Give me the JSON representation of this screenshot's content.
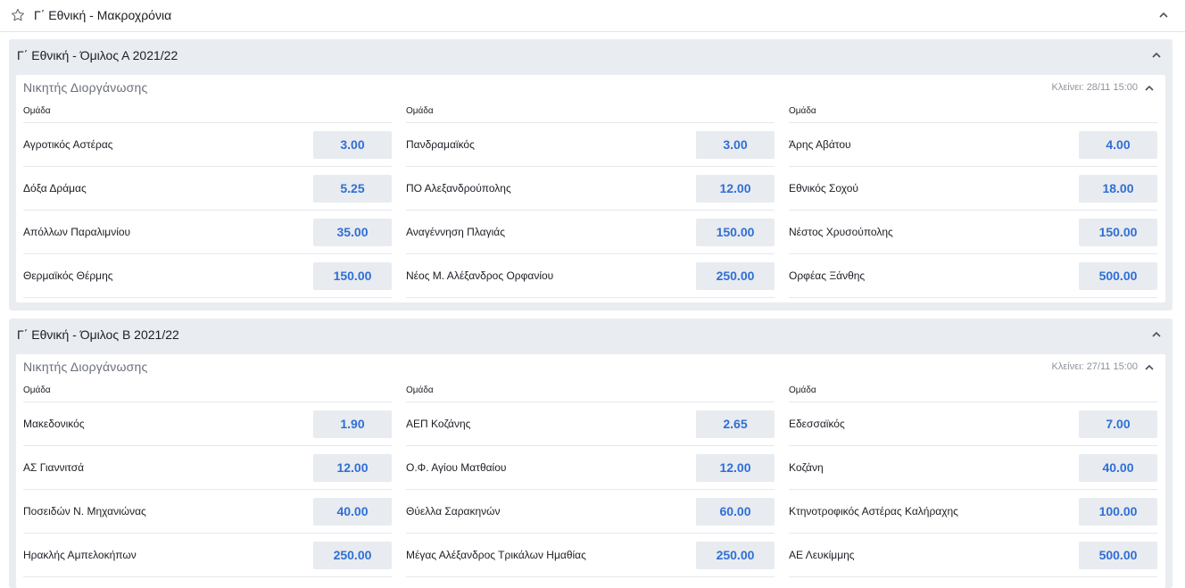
{
  "header": {
    "title": "Γ΄ Εθνική - Μακροχρόνια"
  },
  "sections": [
    {
      "title": "Γ΄ Εθνική - Όμιλος Α 2021/22",
      "market": {
        "title": "Νικητής Διοργάνωσης",
        "closes": "Κλείνει: 28/11 15:00",
        "columns": [
          {
            "header": "Ομάδα",
            "rows": [
              {
                "team": "Αγροτικός Αστέρας",
                "odd": "3.00"
              },
              {
                "team": "Δόξα Δράμας",
                "odd": "5.25"
              },
              {
                "team": "Απόλλων Παραλιμνίου",
                "odd": "35.00"
              },
              {
                "team": "Θερμαϊκός Θέρμης",
                "odd": "150.00"
              }
            ]
          },
          {
            "header": "Ομάδα",
            "rows": [
              {
                "team": "Πανδραμαϊκός",
                "odd": "3.00"
              },
              {
                "team": "ΠΟ Αλεξανδρούπολης",
                "odd": "12.00"
              },
              {
                "team": "Αναγέννηση Πλαγιάς",
                "odd": "150.00"
              },
              {
                "team": "Νέος Μ. Αλέξανδρος Ορφανίου",
                "odd": "250.00"
              }
            ]
          },
          {
            "header": "Ομάδα",
            "rows": [
              {
                "team": "Άρης Αβάτου",
                "odd": "4.00"
              },
              {
                "team": "Εθνικός Σοχού",
                "odd": "18.00"
              },
              {
                "team": "Νέστος Χρυσούπολης",
                "odd": "150.00"
              },
              {
                "team": "Ορφέας Ξάνθης",
                "odd": "500.00"
              }
            ]
          }
        ]
      }
    },
    {
      "title": "Γ΄ Εθνική - Όμιλος Β 2021/22",
      "market": {
        "title": "Νικητής Διοργάνωσης",
        "closes": "Κλείνει: 27/11 15:00",
        "columns": [
          {
            "header": "Ομάδα",
            "rows": [
              {
                "team": "Μακεδονικός",
                "odd": "1.90"
              },
              {
                "team": "ΑΣ Γιαννιτσά",
                "odd": "12.00"
              },
              {
                "team": "Ποσειδών Ν. Μηχανιώνας",
                "odd": "40.00"
              },
              {
                "team": "Ηρακλής Αμπελοκήπων",
                "odd": "250.00"
              }
            ]
          },
          {
            "header": "Ομάδα",
            "rows": [
              {
                "team": "ΑΕΠ Κοζάνης",
                "odd": "2.65"
              },
              {
                "team": "Ο.Φ. Αγίου Ματθαίου",
                "odd": "12.00"
              },
              {
                "team": "Θύελλα Σαρακηνών",
                "odd": "60.00"
              },
              {
                "team": "Μέγας Αλέξανδρος Τρικάλων Ημαθίας",
                "odd": "250.00"
              }
            ]
          },
          {
            "header": "Ομάδα",
            "rows": [
              {
                "team": "Εδεσσαϊκός",
                "odd": "7.00"
              },
              {
                "team": "Κοζάνη",
                "odd": "40.00"
              },
              {
                "team": "Κτηνοτροφικός Αστέρας Καλήραχης",
                "odd": "100.00"
              },
              {
                "team": "ΑΕ Λευκίμμης",
                "odd": "500.00"
              }
            ]
          }
        ]
      }
    }
  ],
  "colors": {
    "accent": "#2f6fd6",
    "odd_bg": "#e8ebef",
    "section_bg": "#e9ecf0"
  },
  "icons": {
    "favorite": "star-icon",
    "collapse": "chevron-up-icon"
  }
}
